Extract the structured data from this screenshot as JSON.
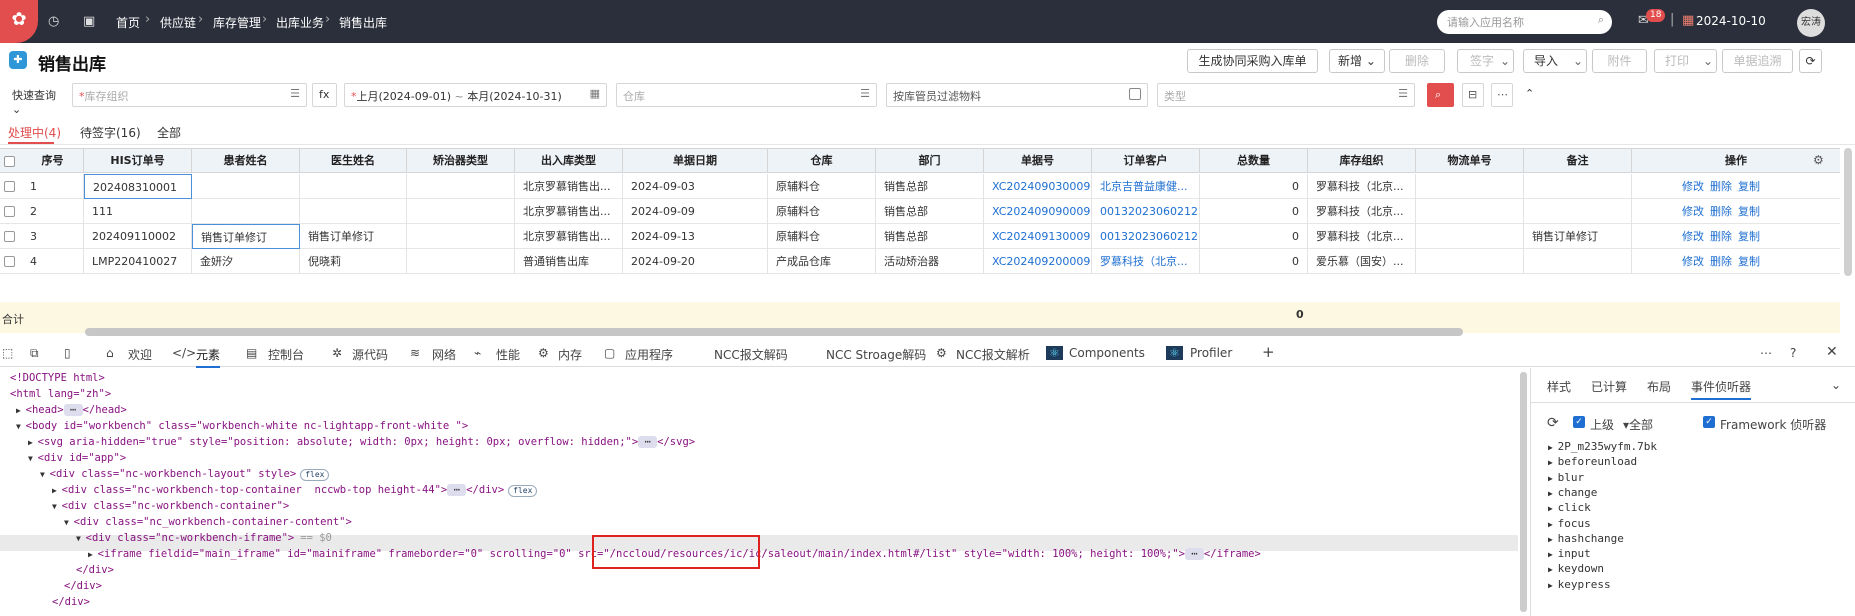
{
  "topbar": {
    "breadcrumb": [
      "首页",
      "供应链",
      "库存管理",
      "出库业务",
      "销售出库"
    ],
    "app_search_placeholder": "请输入应用名称",
    "notification_count": "18",
    "date": "2024-10-10",
    "user": "宏涛"
  },
  "page": {
    "title": "销售出库",
    "buttons": [
      "生成协同采购入库单",
      "新增",
      "删除",
      "签字",
      "导入",
      "附件",
      "打印",
      "单据追溯"
    ]
  },
  "filters": {
    "quick_query": "快速查询",
    "org_placeholder": "库存组织",
    "fx": "fx",
    "date_from": "上月(2024-09-01)",
    "date_to": "本月(2024-10-31)",
    "warehouse_placeholder": "仓库",
    "keeper_filter": "按库管员过滤物料",
    "type_placeholder": "类型"
  },
  "tabs": [
    "处理中(4)",
    "待签字(16)",
    "全部"
  ],
  "table": {
    "headers": [
      "序号",
      "HIS订单号",
      "患者姓名",
      "医生姓名",
      "矫治器类型",
      "出入库类型",
      "单据日期",
      "仓库",
      "部门",
      "单据号",
      "订单客户",
      "总数量",
      "库存组织",
      "物流单号",
      "备注",
      "操作"
    ],
    "rows": [
      {
        "seq": "1",
        "his": "202408310001",
        "patient": "",
        "doctor": "",
        "device": "",
        "type": "北京罗慕销售出...",
        "date": "2024-09-03",
        "wh": "原辅料仓",
        "dept": "销售总部",
        "no": "XC202409030009...",
        "cust": "北京吉普益康健...",
        "qty": "0",
        "org": "罗慕科技（北京...",
        "logi": "",
        "note": "",
        "ops": [
          "修改",
          "删除",
          "复制"
        ]
      },
      {
        "seq": "2",
        "his": "111",
        "patient": "",
        "doctor": "",
        "device": "",
        "type": "北京罗慕销售出...",
        "date": "2024-09-09",
        "wh": "原辅料仓",
        "dept": "销售总部",
        "no": "XC202409090009...",
        "cust": "00132023060212...",
        "qty": "0",
        "org": "罗慕科技（北京...",
        "logi": "",
        "note": "",
        "ops": [
          "修改",
          "删除",
          "复制"
        ]
      },
      {
        "seq": "3",
        "his": "202409110002",
        "patient": "销售订单修订",
        "doctor": "销售订单修订",
        "device": "",
        "type": "北京罗慕销售出...",
        "date": "2024-09-13",
        "wh": "原辅料仓",
        "dept": "销售总部",
        "no": "XC202409130009...",
        "cust": "00132023060212...",
        "qty": "0",
        "org": "罗慕科技（北京...",
        "logi": "",
        "note": "销售订单修订",
        "ops": [
          "修改",
          "删除",
          "复制"
        ]
      },
      {
        "seq": "4",
        "his": "LMP220410027",
        "patient": "金妍汐",
        "doctor": "倪晓莉",
        "device": "",
        "type": "普通销售出库",
        "date": "2024-09-20",
        "wh": "产成品仓库",
        "dept": "活动矫治器",
        "no": "XC202409200009...",
        "cust": "罗慕科技（北京...",
        "qty": "0",
        "org": "爱乐慕（国安）...",
        "logi": "",
        "note": "",
        "ops": [
          "修改",
          "删除",
          "复制"
        ]
      }
    ],
    "sum_label": "合计",
    "sum_qty": "0"
  },
  "devtools": {
    "tabs": [
      "欢迎",
      "元素",
      "控制台",
      "源代码",
      "网络",
      "性能",
      "内存",
      "应用程序",
      "NCC报文解码",
      "NCC Stroage解码",
      "NCC报文解析",
      "Components",
      "Profiler"
    ],
    "code_lines": [
      "<!DOCTYPE html>",
      "<html lang=\"zh\">",
      "<head>",
      "</head>",
      "<body id=\"workbench\" class=\"workbench-white nc-lightapp-front-white \">",
      "<svg aria-hidden=\"true\" style=\"position: absolute; width: 0px; height: 0px; overflow: hidden;\">",
      "</svg>",
      "<div id=\"app\">",
      "<div class=\"nc-workbench-layout\" style>",
      "flex",
      "<div class=\"nc-workbench-top-container  nccwb-top height-44\">",
      "</div>",
      "<div class=\"nc-workbench-container\">",
      "<div class=\"nc_workbench-container-content\">",
      "<div class=\"nc-workbench-iframe\">",
      "== $0",
      "<iframe fieldid=\"main_iframe\" id=\"mainiframe\" frameborder=\"0\" scrolling=\"0\" src=\"/nccloud/resources/ic/ic/saleout/main/index.html#/list\" style=\"width: 100%; height: 100%;\">",
      "</iframe>",
      "</div>",
      "</div>"
    ],
    "right_tabs": [
      "样式",
      "已计算",
      "布局",
      "事件侦听器"
    ],
    "ancestors_label": "上级",
    "all_label": "全部",
    "framework_label": "Framework 侦听器",
    "events": [
      "2P_m235wyfm.7bk",
      "beforeunload",
      "blur",
      "change",
      "click",
      "focus",
      "hashchange",
      "input",
      "keydown",
      "keypress"
    ]
  }
}
